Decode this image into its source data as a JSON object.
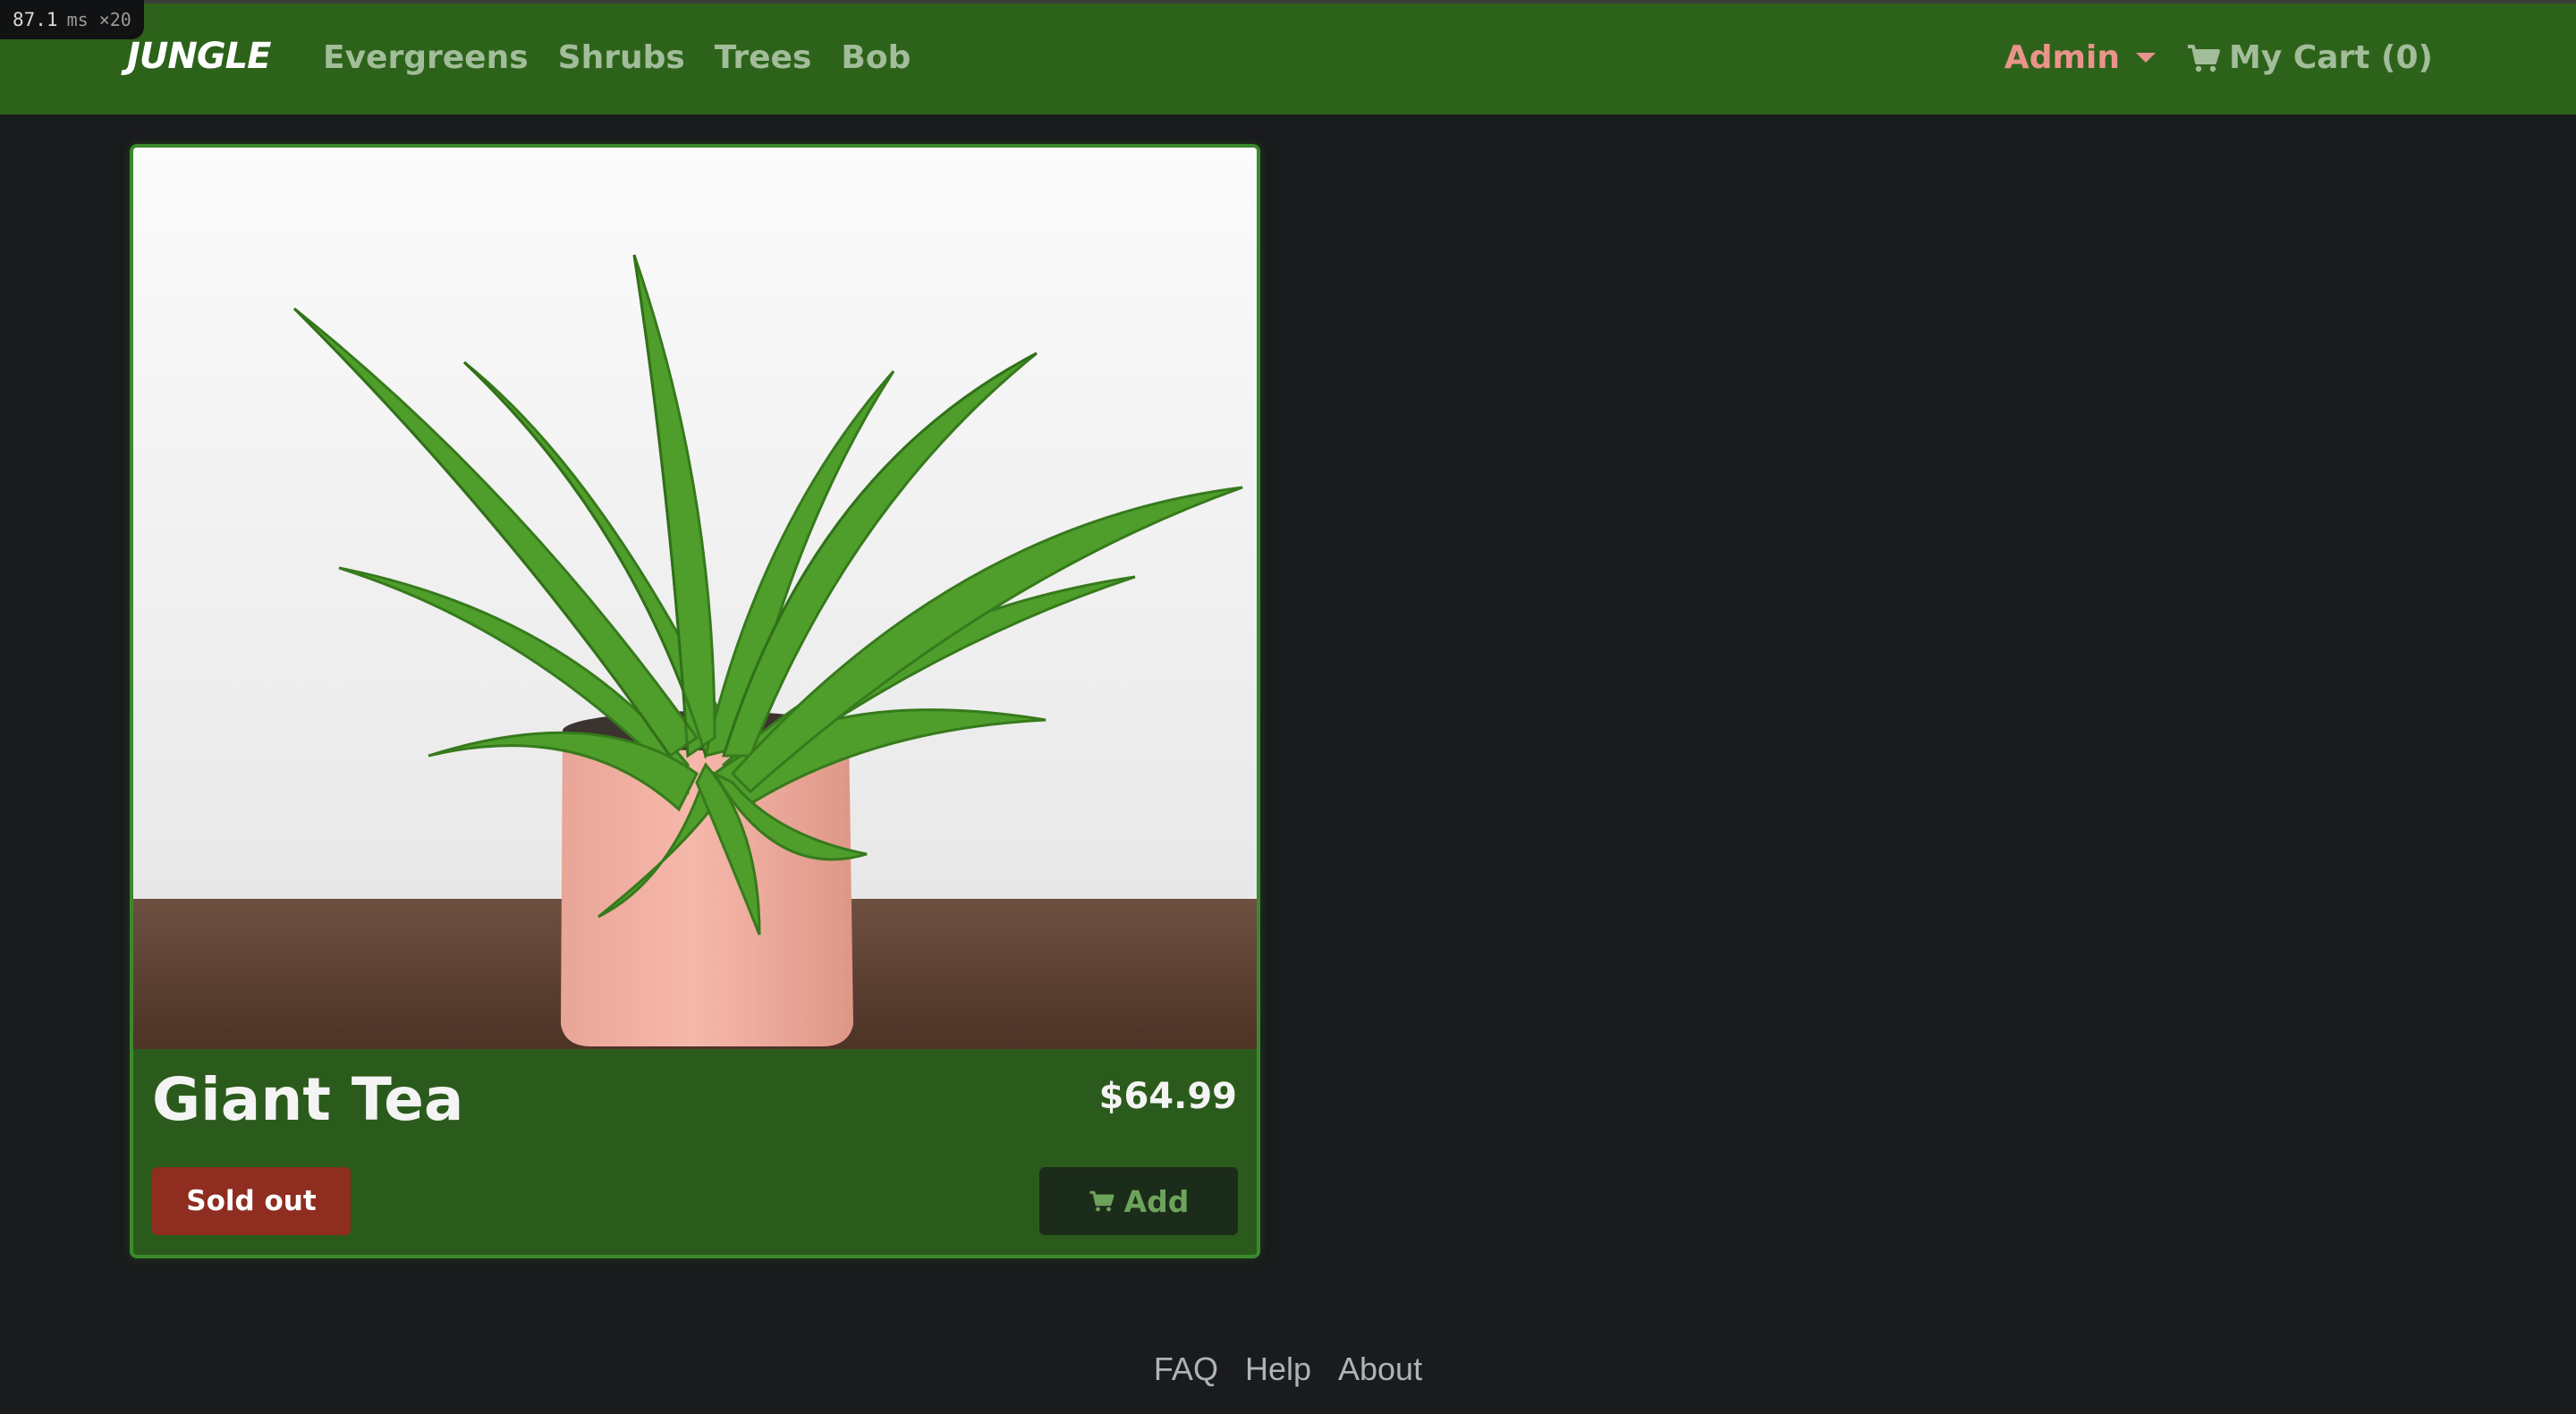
{
  "perf": {
    "value": "87.1",
    "unit": "ms ×20"
  },
  "navbar": {
    "brand": "JUNGLE",
    "links": [
      "Evergreens",
      "Shrubs",
      "Trees",
      "Bob"
    ],
    "admin_label": "Admin",
    "cart_label": "My Cart (0)"
  },
  "product": {
    "name": "Giant Tea",
    "price": "$64.99",
    "status_badge": "Sold out",
    "add_label": "Add"
  },
  "footer": {
    "links": [
      "FAQ",
      "Help",
      "About"
    ]
  },
  "colors": {
    "navbar_bg": "#2d621b",
    "card_bg": "#2b5b1c",
    "sold_out_bg": "#8e2d20",
    "admin_color": "#e9948a",
    "page_bg": "#1a1b1d"
  },
  "icons": [
    "cart-icon",
    "chevron-down-icon"
  ]
}
